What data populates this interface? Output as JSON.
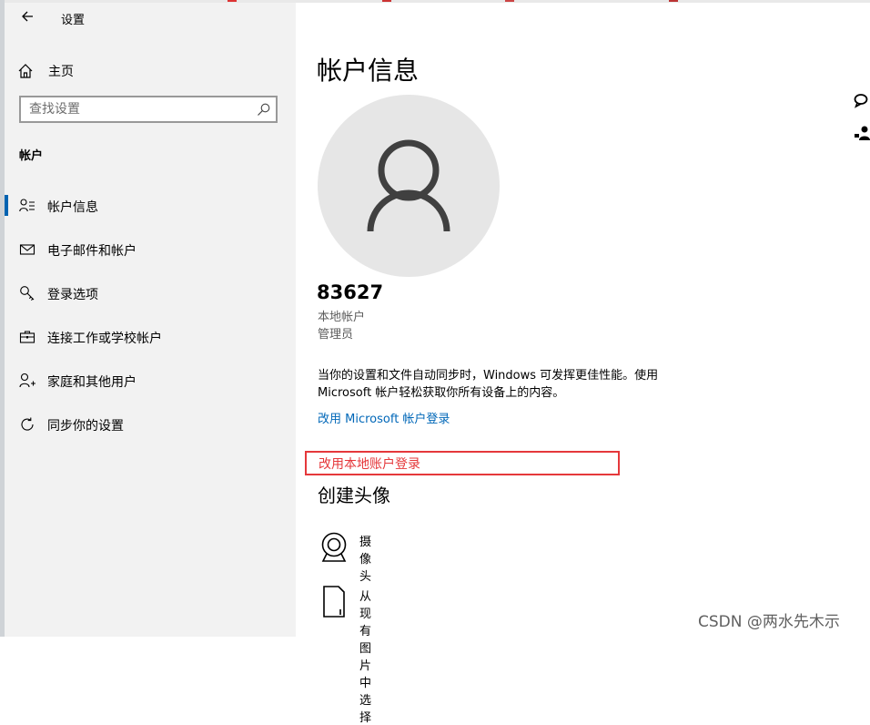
{
  "sidebar": {
    "app_title": "设置",
    "home_label": "主页",
    "search_placeholder": "查找设置",
    "section_heading": "帐户",
    "items": [
      {
        "label": "帐户信息"
      },
      {
        "label": "电子邮件和帐户"
      },
      {
        "label": "登录选项"
      },
      {
        "label": "连接工作或学校帐户"
      },
      {
        "label": "家庭和其他用户"
      },
      {
        "label": "同步你的设置"
      }
    ]
  },
  "main": {
    "title": "帐户信息",
    "user_name": "83627",
    "account_type": "本地帐户",
    "account_role": "管理员",
    "description": "当你的设置和文件自动同步时，Windows 可发挥更佳性能。使用 Microsoft 帐户轻松获取你所有设备上的内容。",
    "ms_link": "改用 Microsoft 帐户登录",
    "local_link": "改用本地账户登录",
    "create_avatar_heading": "创建头像",
    "options": [
      {
        "label": "摄像头"
      },
      {
        "label": "从现有图片中选择"
      }
    ]
  },
  "watermark": "CSDN @两水先木示",
  "colors": {
    "accent": "#0063b1",
    "link": "#0067b8",
    "highlight": "#e5383b",
    "sidebar_bg": "#f2f2f2",
    "avatar_bg": "#e6e6e6"
  }
}
